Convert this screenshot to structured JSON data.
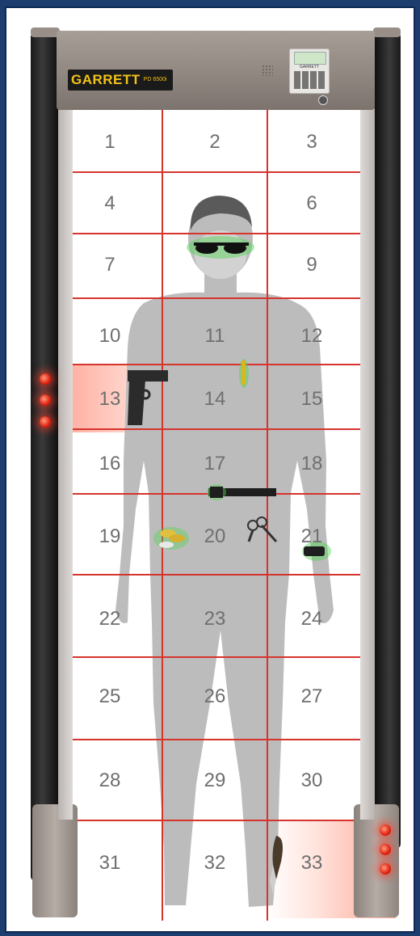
{
  "header": {
    "brand": "GARRETT",
    "sub_brand": "PD 6500i",
    "panel_brand": "GARRETT"
  },
  "zones": [
    {
      "id": "1",
      "label": "1"
    },
    {
      "id": "2",
      "label": "2"
    },
    {
      "id": "3",
      "label": "3"
    },
    {
      "id": "4",
      "label": "4"
    },
    {
      "id": "6",
      "label": "6"
    },
    {
      "id": "7",
      "label": "7"
    },
    {
      "id": "9",
      "label": "9"
    },
    {
      "id": "10",
      "label": "10"
    },
    {
      "id": "11",
      "label": "11"
    },
    {
      "id": "12",
      "label": "12"
    },
    {
      "id": "13",
      "label": "13"
    },
    {
      "id": "14",
      "label": "14"
    },
    {
      "id": "15",
      "label": "15"
    },
    {
      "id": "16",
      "label": "16"
    },
    {
      "id": "17",
      "label": "17"
    },
    {
      "id": "18",
      "label": "18"
    },
    {
      "id": "19",
      "label": "19"
    },
    {
      "id": "20",
      "label": "20"
    },
    {
      "id": "21",
      "label": "21"
    },
    {
      "id": "22",
      "label": "22"
    },
    {
      "id": "23",
      "label": "23"
    },
    {
      "id": "24",
      "label": "24"
    },
    {
      "id": "25",
      "label": "25"
    },
    {
      "id": "26",
      "label": "26"
    },
    {
      "id": "27",
      "label": "27"
    },
    {
      "id": "28",
      "label": "28"
    },
    {
      "id": "29",
      "label": "29"
    },
    {
      "id": "30",
      "label": "30"
    },
    {
      "id": "31",
      "label": "31"
    },
    {
      "id": "32",
      "label": "32"
    },
    {
      "id": "33",
      "label": "33"
    }
  ],
  "alarm_zones": [
    "13",
    "33"
  ],
  "detected_items": [
    "sunglasses-icon",
    "pen-icon",
    "gun-icon",
    "belt-buckle-icon",
    "coins-icon",
    "keys-icon",
    "watch-icon",
    "knife-icon"
  ],
  "colors": {
    "grid": "#d6332c",
    "silhouette": "#b9b9b9",
    "alarm_glow": "#ff5a3c",
    "detect_glow": "#4fd14f"
  }
}
